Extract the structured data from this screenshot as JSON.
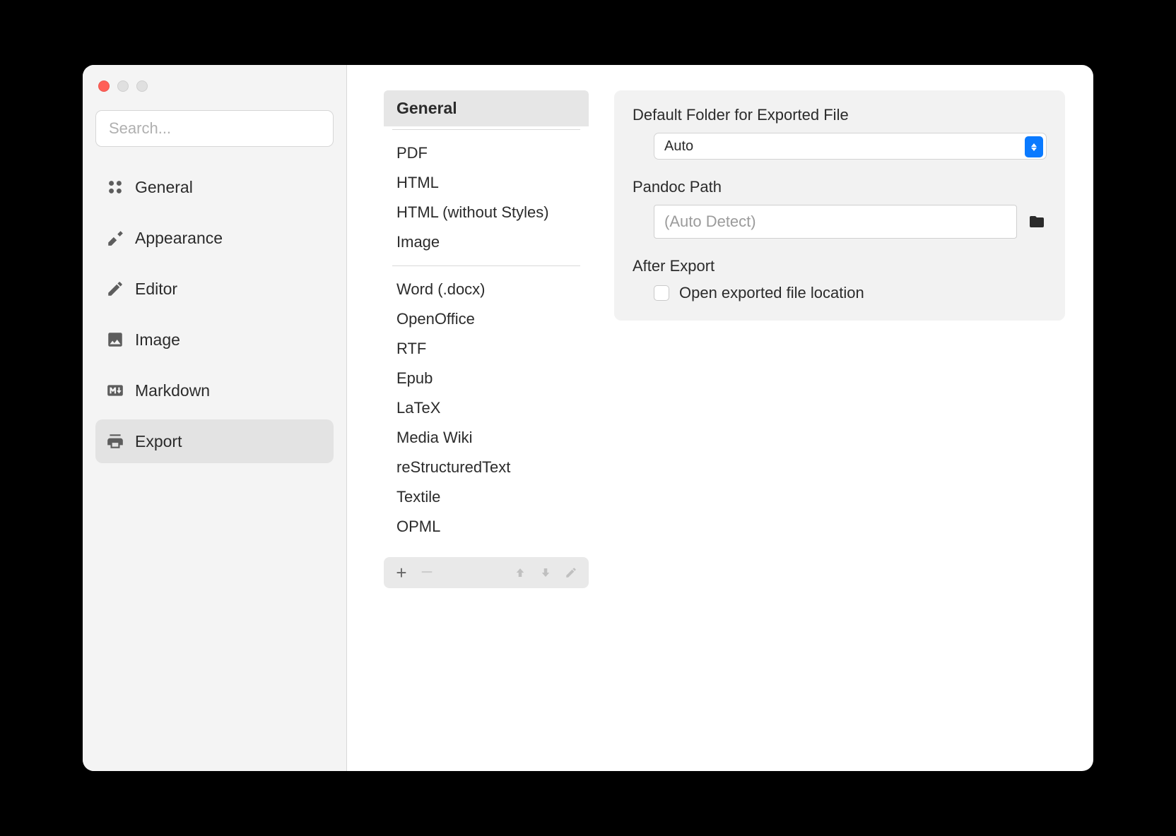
{
  "sidebar": {
    "search_placeholder": "Search...",
    "items": [
      {
        "label": "General",
        "icon": "grid-icon"
      },
      {
        "label": "Appearance",
        "icon": "paint-icon"
      },
      {
        "label": "Editor",
        "icon": "pencil-icon"
      },
      {
        "label": "Image",
        "icon": "image-icon"
      },
      {
        "label": "Markdown",
        "icon": "markdown-icon"
      },
      {
        "label": "Export",
        "icon": "printer-icon"
      }
    ],
    "active_index": 5
  },
  "export_list": {
    "header": "General",
    "group1": [
      "PDF",
      "HTML",
      "HTML (without Styles)",
      "Image"
    ],
    "group2": [
      "Word (.docx)",
      "OpenOffice",
      "RTF",
      "Epub",
      "LaTeX",
      "Media Wiki",
      "reStructuredText",
      "Textile",
      "OPML"
    ]
  },
  "panel": {
    "default_folder_label": "Default Folder for Exported File",
    "default_folder_value": "Auto",
    "pandoc_label": "Pandoc Path",
    "pandoc_placeholder": "(Auto Detect)",
    "after_export_label": "After Export",
    "after_export_checkbox_label": "Open exported file location",
    "after_export_checked": false
  }
}
